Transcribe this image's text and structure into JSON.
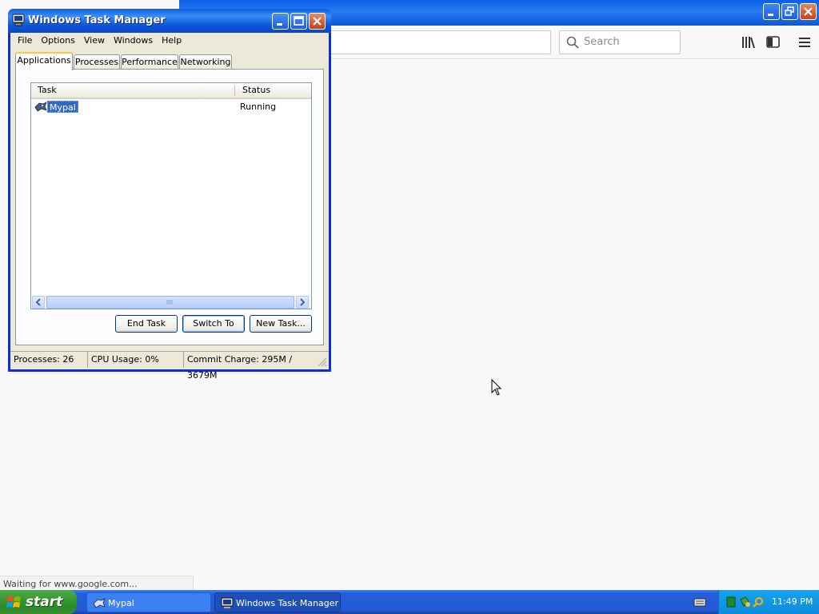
{
  "browser": {
    "search_placeholder": "Search",
    "status_text": "Waiting for www.google.com..."
  },
  "task_manager": {
    "title": "Windows Task Manager",
    "menu": [
      "File",
      "Options",
      "View",
      "Windows",
      "Help"
    ],
    "tabs": [
      "Applications",
      "Processes",
      "Performance",
      "Networking"
    ],
    "active_tab": "Applications",
    "columns": {
      "task": "Task",
      "status": "Status"
    },
    "rows": [
      {
        "task": "Mypal",
        "status": "Running",
        "selected": true
      }
    ],
    "buttons": {
      "end_task": "End Task",
      "switch_to": "Switch To",
      "new_task": "New Task..."
    },
    "statusbar": {
      "processes": "Processes: 26",
      "cpu": "CPU Usage: 0%",
      "commit": "Commit Charge: 295M / 3679M"
    }
  },
  "taskbar": {
    "start_label": "start",
    "items": [
      {
        "label": "Mypal",
        "icon": "mypal-icon",
        "active": false
      },
      {
        "label": "Windows Task Manager",
        "icon": "task-manager-icon",
        "active": true
      }
    ],
    "clock": "11:49 PM"
  },
  "colors": {
    "xp_blue": "#0a5ee6",
    "selection": "#316ac5",
    "start_green": "#3c9c35",
    "tray_blue": "#0d8cdc"
  }
}
